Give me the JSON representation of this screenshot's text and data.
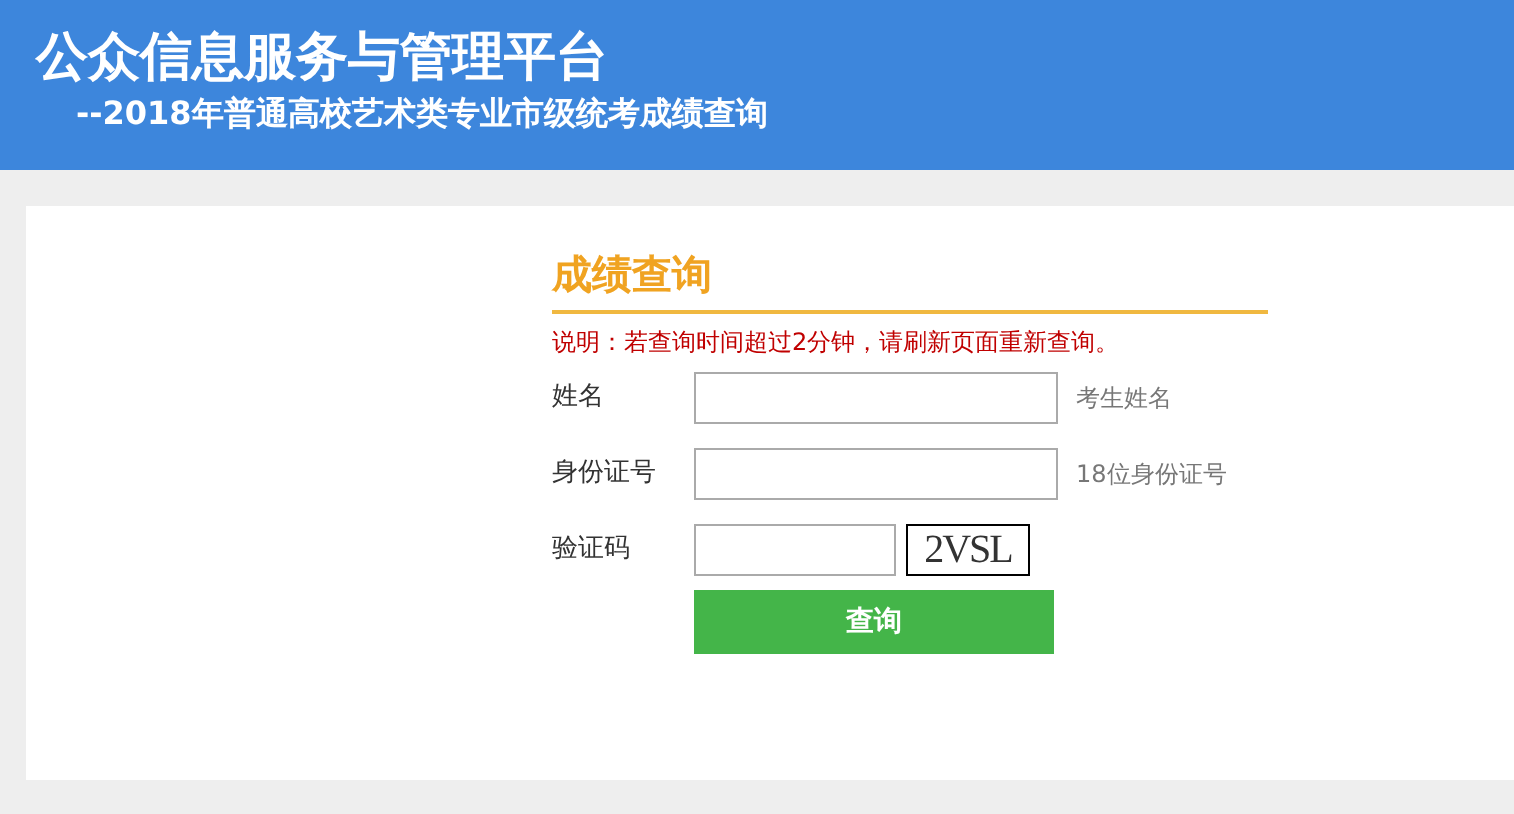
{
  "header": {
    "title": "公众信息服务与管理平台",
    "subtitle": "--2018年普通高校艺术类专业市级统考成绩查询"
  },
  "form": {
    "title": "成绩查询",
    "note": "说明：若查询时间超过2分钟，请刷新页面重新查询。",
    "fields": [
      {
        "kind": "text",
        "label": "姓名",
        "hint": "考生姓名"
      },
      {
        "kind": "text",
        "label": "身份证号",
        "hint": "18位身份证号"
      },
      {
        "kind": "captcha",
        "label": "验证码",
        "captcha": "2VSL"
      }
    ],
    "button": "查询"
  }
}
